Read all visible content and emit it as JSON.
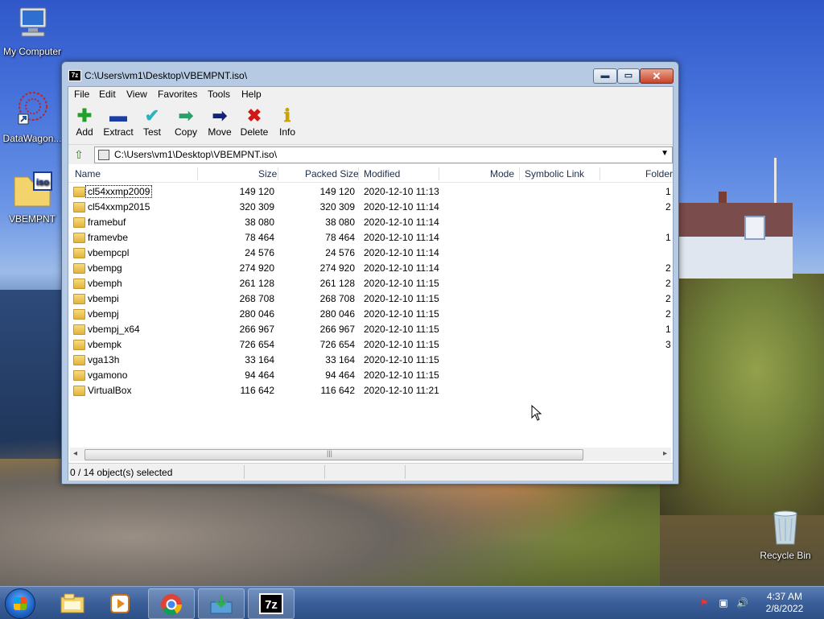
{
  "desktop": {
    "icons": [
      {
        "label": "My Computer"
      },
      {
        "label": "DataWagon..."
      },
      {
        "label": "VBEMPNT"
      },
      {
        "label": "Recycle Bin"
      }
    ],
    "iso_badge": "iso"
  },
  "window": {
    "title": "C:\\Users\\vm1\\Desktop\\VBEMPNT.iso\\",
    "app_badge": "7z",
    "controls": {
      "minimize": "▬",
      "maximize": "▭",
      "close": "✕"
    },
    "menu": [
      "File",
      "Edit",
      "View",
      "Favorites",
      "Tools",
      "Help"
    ],
    "toolbar": [
      {
        "label": "Add",
        "glyph": "✚",
        "color": "#22a02a"
      },
      {
        "label": "Extract",
        "glyph": "▬",
        "color": "#1c3ca8"
      },
      {
        "label": "Test",
        "glyph": "✔",
        "color": "#2bb3c0"
      },
      {
        "label": "Copy",
        "glyph": "➡",
        "color": "#2aa06a"
      },
      {
        "label": "Move",
        "glyph": "➡",
        "color": "#15227a"
      },
      {
        "label": "Delete",
        "glyph": "✖",
        "color": "#d01818"
      },
      {
        "label": "Info",
        "glyph": "ℹ",
        "color": "#c9a400"
      }
    ],
    "address": {
      "path": "C:\\Users\\vm1\\Desktop\\VBEMPNT.iso\\",
      "dropdown": "▼",
      "up": "⇧"
    },
    "columns": {
      "name": "Name",
      "size": "Size",
      "packed": "Packed Size",
      "modified": "Modified",
      "mode": "Mode",
      "symlink": "Symbolic Link",
      "folders": "Folder"
    },
    "files": [
      {
        "name": "cl54xxmp2009",
        "size": "149 120",
        "packed": "149 120",
        "modified": "2020-12-10 11:13",
        "folders": "1"
      },
      {
        "name": "cl54xxmp2015",
        "size": "320 309",
        "packed": "320 309",
        "modified": "2020-12-10 11:14",
        "folders": "2"
      },
      {
        "name": "framebuf",
        "size": "38 080",
        "packed": "38 080",
        "modified": "2020-12-10 11:14",
        "folders": ""
      },
      {
        "name": "framevbe",
        "size": "78 464",
        "packed": "78 464",
        "modified": "2020-12-10 11:14",
        "folders": "1"
      },
      {
        "name": "vbempcpl",
        "size": "24 576",
        "packed": "24 576",
        "modified": "2020-12-10 11:14",
        "folders": ""
      },
      {
        "name": "vbempg",
        "size": "274 920",
        "packed": "274 920",
        "modified": "2020-12-10 11:14",
        "folders": "2"
      },
      {
        "name": "vbemph",
        "size": "261 128",
        "packed": "261 128",
        "modified": "2020-12-10 11:15",
        "folders": "2"
      },
      {
        "name": "vbempi",
        "size": "268 708",
        "packed": "268 708",
        "modified": "2020-12-10 11:15",
        "folders": "2"
      },
      {
        "name": "vbempj",
        "size": "280 046",
        "packed": "280 046",
        "modified": "2020-12-10 11:15",
        "folders": "2"
      },
      {
        "name": "vbempj_x64",
        "size": "266 967",
        "packed": "266 967",
        "modified": "2020-12-10 11:15",
        "folders": "1"
      },
      {
        "name": "vbempk",
        "size": "726 654",
        "packed": "726 654",
        "modified": "2020-12-10 11:15",
        "folders": "3"
      },
      {
        "name": "vga13h",
        "size": "33 164",
        "packed": "33 164",
        "modified": "2020-12-10 11:15",
        "folders": ""
      },
      {
        "name": "vgamono",
        "size": "94 464",
        "packed": "94 464",
        "modified": "2020-12-10 11:15",
        "folders": ""
      },
      {
        "name": "VirtualBox",
        "size": "116 642",
        "packed": "116 642",
        "modified": "2020-12-10 11:21",
        "folders": ""
      }
    ],
    "scroll": {
      "left": "◂",
      "right": "▸",
      "grip": "|||"
    },
    "status": "0 / 14 object(s) selected"
  },
  "taskbar": {
    "buttons": [
      {
        "name": "explorer",
        "glyph": "▤"
      },
      {
        "name": "media-player",
        "glyph": "▶"
      },
      {
        "name": "chrome",
        "glyph": "●"
      },
      {
        "name": "installer",
        "glyph": "⤓"
      },
      {
        "name": "7zip",
        "glyph": "7z"
      }
    ],
    "tray": {
      "flag": "⚑",
      "network": "▣",
      "volume": "🔊"
    },
    "clock": {
      "time": "4:37 AM",
      "date": "2/8/2022"
    }
  }
}
